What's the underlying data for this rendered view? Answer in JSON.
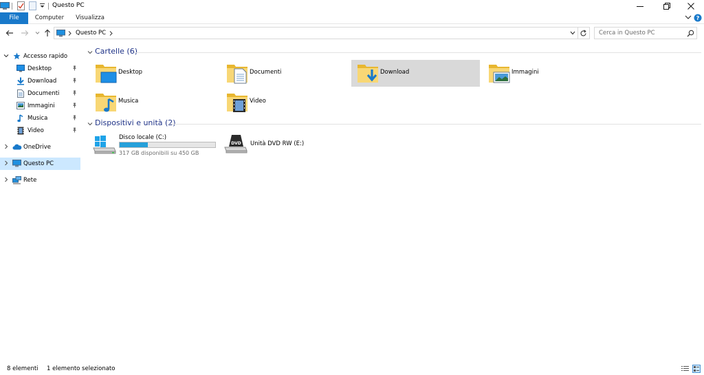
{
  "window": {
    "title": "Questo PC",
    "accent": "#1979ca"
  },
  "ribbon": {
    "tabs": [
      {
        "label": "File"
      },
      {
        "label": "Computer"
      },
      {
        "label": "Visualizza"
      }
    ]
  },
  "address": {
    "crumb": "Questo PC",
    "search_placeholder": "Cerca in Questo PC"
  },
  "nav": {
    "quick_access": "Accesso rapido",
    "quick_items": [
      {
        "label": "Desktop",
        "icon": "desktop-icon",
        "pinned": true
      },
      {
        "label": "Download",
        "icon": "download-icon",
        "pinned": true
      },
      {
        "label": "Documenti",
        "icon": "documents-icon",
        "pinned": true
      },
      {
        "label": "Immagini",
        "icon": "pictures-icon",
        "pinned": true
      },
      {
        "label": "Musica",
        "icon": "music-icon",
        "pinned": true
      },
      {
        "label": "Video",
        "icon": "video-icon",
        "pinned": true
      }
    ],
    "onedrive": "OneDrive",
    "this_pc": "Questo PC",
    "network": "Rete"
  },
  "content": {
    "folders_group": "Cartelle (6)",
    "folders": [
      {
        "label": "Desktop",
        "icon": "desktop-folder-icon"
      },
      {
        "label": "Documenti",
        "icon": "documents-folder-icon"
      },
      {
        "label": "Download",
        "icon": "download-folder-icon",
        "selected": true
      },
      {
        "label": "Immagini",
        "icon": "pictures-folder-icon"
      },
      {
        "label": "Musica",
        "icon": "music-folder-icon"
      },
      {
        "label": "Video",
        "icon": "video-folder-icon"
      }
    ],
    "devices_group": "Dispositivi e unità (2)",
    "devices": [
      {
        "label": "Disco locale (C:)",
        "free_text": "317 GB disponibili su 450 GB",
        "used_fraction": 0.296,
        "icon": "hard-drive-icon"
      },
      {
        "label": "Unità DVD RW (E:)",
        "icon": "dvd-drive-icon"
      }
    ]
  },
  "status": {
    "count": "8 elementi",
    "selection": "1 elemento selezionato"
  }
}
